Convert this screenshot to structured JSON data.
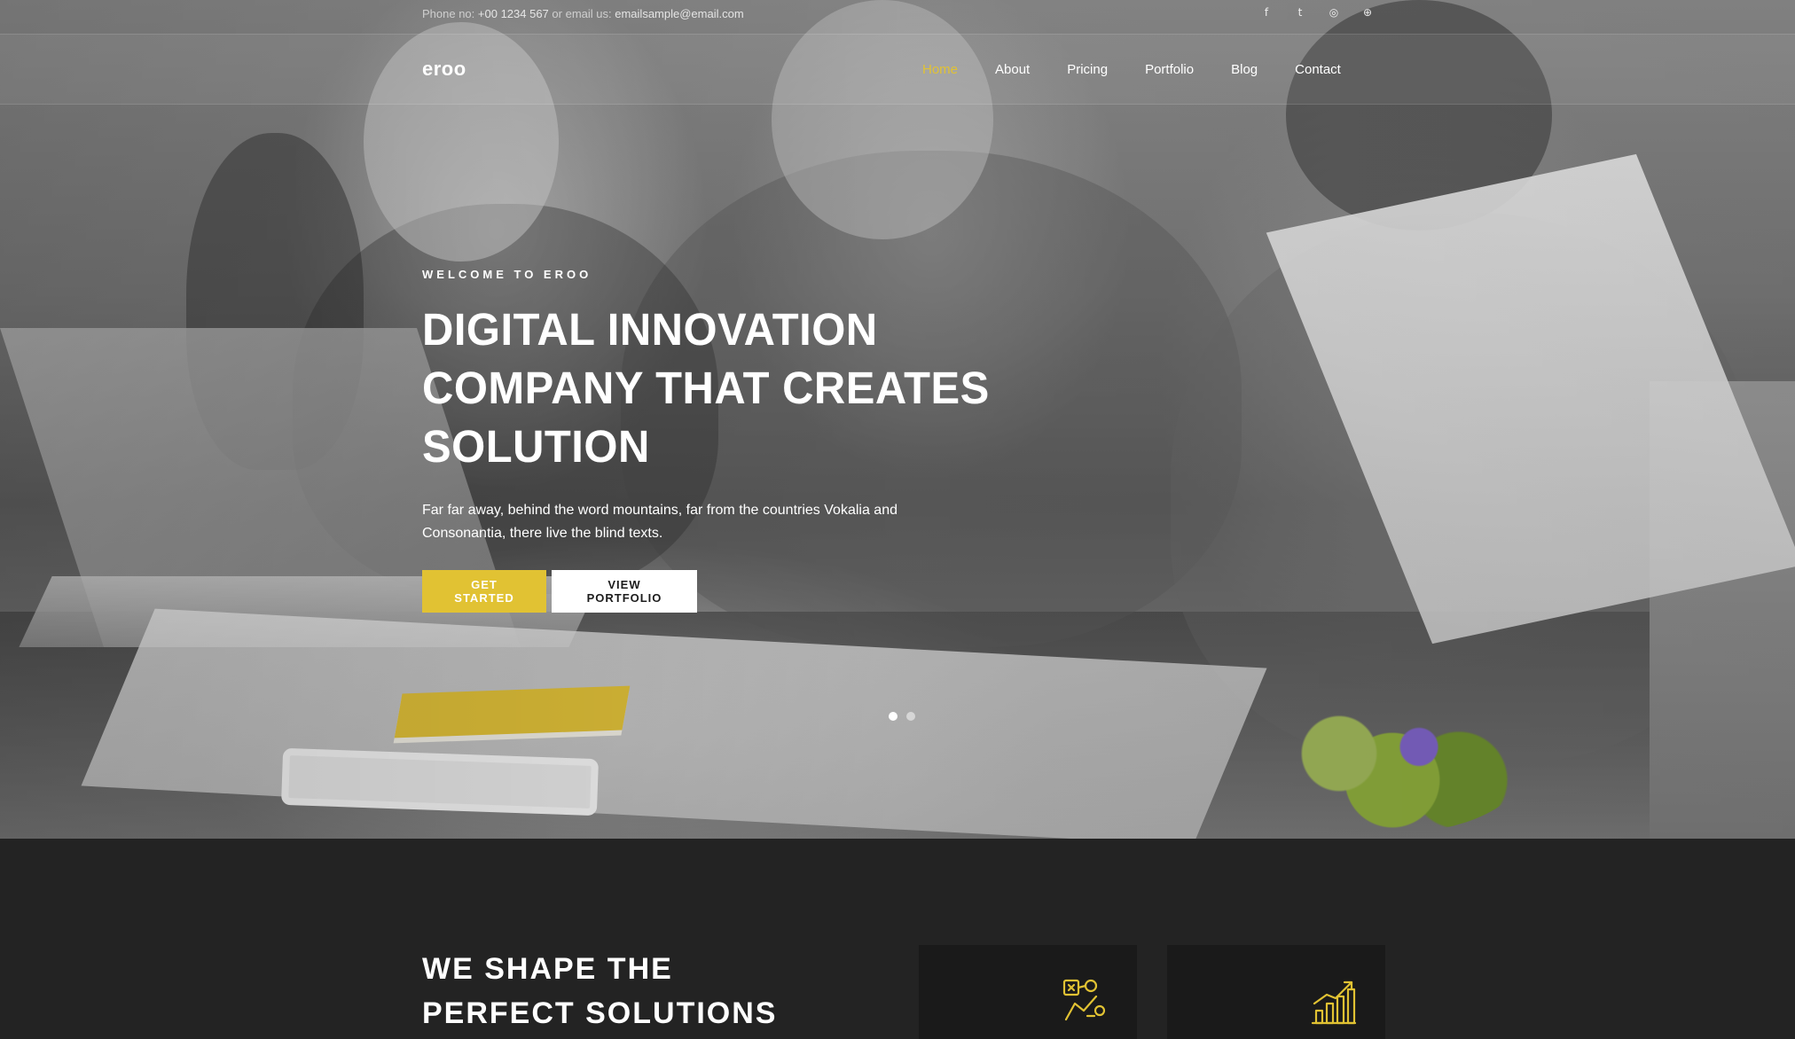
{
  "topbar": {
    "phone_label": "Phone no:",
    "phone": "+00 1234 567",
    "email_label": "or email us:",
    "email": "emailsample@email.com",
    "socials": [
      {
        "icon": "facebook-icon",
        "glyph": "f"
      },
      {
        "icon": "twitter-icon",
        "glyph": "t"
      },
      {
        "icon": "instagram-icon",
        "glyph": "◎"
      },
      {
        "icon": "dribbble-icon",
        "glyph": "⊕"
      }
    ]
  },
  "navbar": {
    "logo": "eroo",
    "menu": [
      "Home",
      "About",
      "Pricing",
      "Portfolio",
      "Blog",
      "Contact"
    ],
    "active": "Home"
  },
  "hero": {
    "eyebrow": "WELCOME TO EROO",
    "headline_line1": "Digital Innovation",
    "headline_line2": "Company That Creates",
    "headline_line3": "Solution",
    "lead": "Far far away, behind the word mountains, far from the countries Vokalia and Consonantia, there live the blind texts.",
    "primary_button": "GET STARTED",
    "secondary_button": "VIEW PORTFOLIO",
    "slides": 2,
    "active_slide": 1
  },
  "section": {
    "title_line1": "We Shape The",
    "title_line2": "Perfect Solutions",
    "cards": [
      {
        "icon": "strategy-board-icon"
      },
      {
        "icon": "growth-chart-icon"
      }
    ]
  },
  "colors": {
    "accent": "#e1c233",
    "dark_bg": "#232323",
    "card_bg": "#1a1a1a",
    "text": "#ffffff"
  }
}
